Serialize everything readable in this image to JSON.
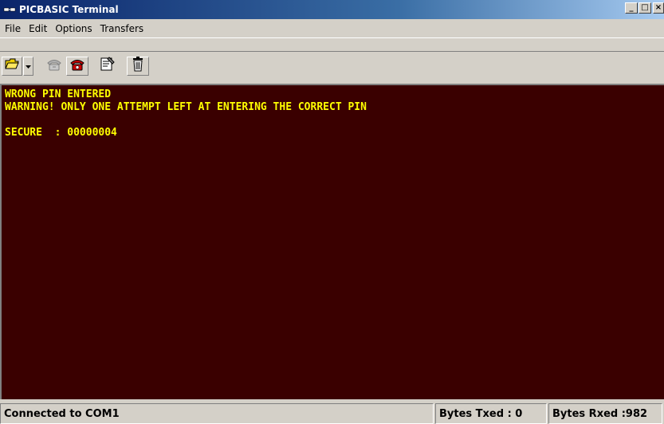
{
  "window": {
    "title": "PICBASIC Terminal",
    "title_icon": "serial-plug-icon",
    "buttons": {
      "minimize": "_",
      "maximize": "□",
      "close": "×"
    }
  },
  "menu": {
    "items": [
      "File",
      "Edit",
      "Options",
      "Transfers"
    ]
  },
  "toolbar": {
    "icons": [
      "open-folder-icon",
      "dropdown-arrow-icon",
      "disconnect-phone-icon",
      "connect-phone-icon",
      "properties-icon",
      "trash-icon"
    ]
  },
  "terminal": {
    "lines": [
      "WRONG PIN ENTERED",
      "WARNING! ONLY ONE ATTEMPT LEFT AT ENTERING THE CORRECT PIN",
      "",
      "SECURE  : 00000004"
    ],
    "colors": {
      "background": "#3a0000",
      "text": "#ffff00"
    }
  },
  "status": {
    "connection": "Connected to COM1",
    "bytes_txed": "Bytes Txed : 0",
    "bytes_rxed": "Bytes Rxed :982"
  }
}
